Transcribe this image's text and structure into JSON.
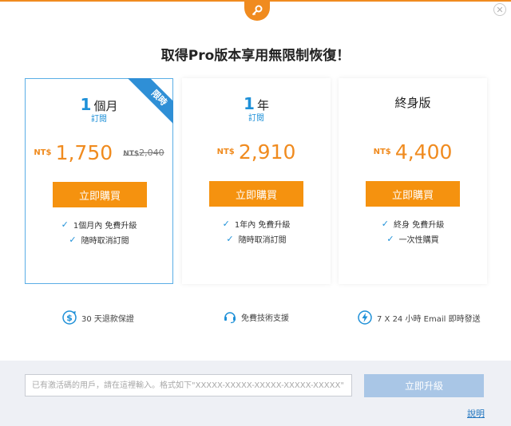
{
  "headline": "取得Pro版本享用無限制恢復！",
  "plans": [
    {
      "num": "1",
      "unit": "個月",
      "sub": "訂閱",
      "currency": "NT$",
      "price": "1,750",
      "old_currency": "NT$",
      "old_price": "2,040",
      "buy_label": "立即購買",
      "features": [
        "1個月內 免費升級",
        "隨時取消訂閱"
      ],
      "ribbon": "限時",
      "selected": true
    },
    {
      "num": "1",
      "unit": "年",
      "sub": "訂閱",
      "currency": "NT$",
      "price": "2,910",
      "buy_label": "立即購買",
      "features": [
        "1年內 免費升級",
        "隨時取消訂閱"
      ]
    },
    {
      "title": "終身版",
      "currency": "NT$",
      "price": "4,400",
      "buy_label": "立即購買",
      "features": [
        "終身 免費升級",
        "一次性購買"
      ]
    }
  ],
  "perks": {
    "refund": "30 天退款保證",
    "support": "免費技術支援",
    "delivery": "7 X 24 小時 Email 即時發送"
  },
  "license": {
    "placeholder": "已有激活碼的用戶，請在這裡輸入。格式如下\"XXXXX-XXXXX-XXXXX-XXXXX-XXXXX\"",
    "upgrade_label": "立即升級",
    "help_label": "說明"
  },
  "icons": {
    "key": "key-icon",
    "close": "close-icon",
    "check": "check-icon",
    "refund": "dollar-cycle-icon",
    "support": "headset-icon",
    "delivery": "lightning-icon"
  },
  "colors": {
    "accent_orange": "#f08b1f",
    "accent_blue": "#1e90d8",
    "upgrade_disabled": "#a9c6e6"
  }
}
